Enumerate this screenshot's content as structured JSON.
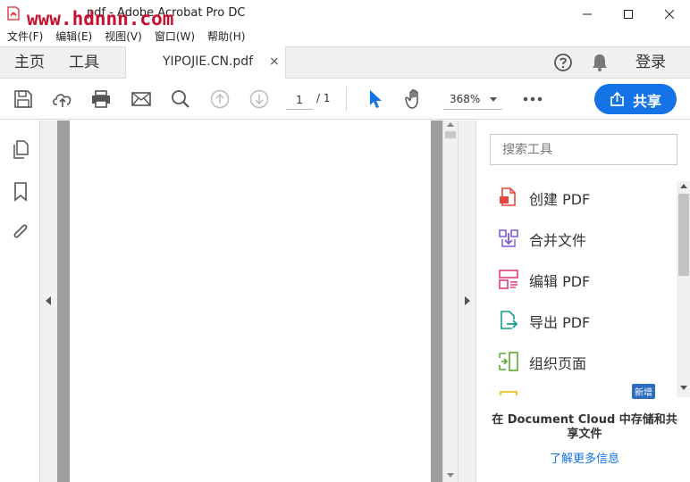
{
  "window": {
    "title": "pdf - Adobe Acrobat Pro DC",
    "watermark": "www.hdnnn.com"
  },
  "menu": [
    {
      "label": "文件(F)"
    },
    {
      "label": "编辑(E)"
    },
    {
      "label": "视图(V)"
    },
    {
      "label": "窗口(W)"
    },
    {
      "label": "帮助(H)"
    }
  ],
  "tabs": {
    "home": "主页",
    "tools": "工具",
    "document": "YIPOJIE.CN.pdf",
    "close_symbol": "×",
    "login": "登录"
  },
  "toolbar": {
    "page_current": "1",
    "page_total": "/ 1",
    "zoom": "368%",
    "share_label": "共享"
  },
  "tools_pane": {
    "search_placeholder": "搜索工具",
    "items": [
      {
        "label": "创建 PDF",
        "icon": "create-pdf-icon",
        "color": "#e8463a"
      },
      {
        "label": "合并文件",
        "icon": "combine-files-icon",
        "color": "#7b5bd6"
      },
      {
        "label": "编辑 PDF",
        "icon": "edit-pdf-icon",
        "color": "#e03a7c"
      },
      {
        "label": "导出 PDF",
        "icon": "export-pdf-icon",
        "color": "#159b8f"
      },
      {
        "label": "组织页面",
        "icon": "organize-pages-icon",
        "color": "#5ca82e"
      }
    ],
    "new_badge": "新增",
    "cloud_promo": "在 Document Cloud 中存储和共享文件",
    "learn_more": "了解更多信息"
  },
  "colors": {
    "accent": "#1473e6",
    "acrobat_red": "#d7282f",
    "watermark_red": "#c8102e"
  }
}
